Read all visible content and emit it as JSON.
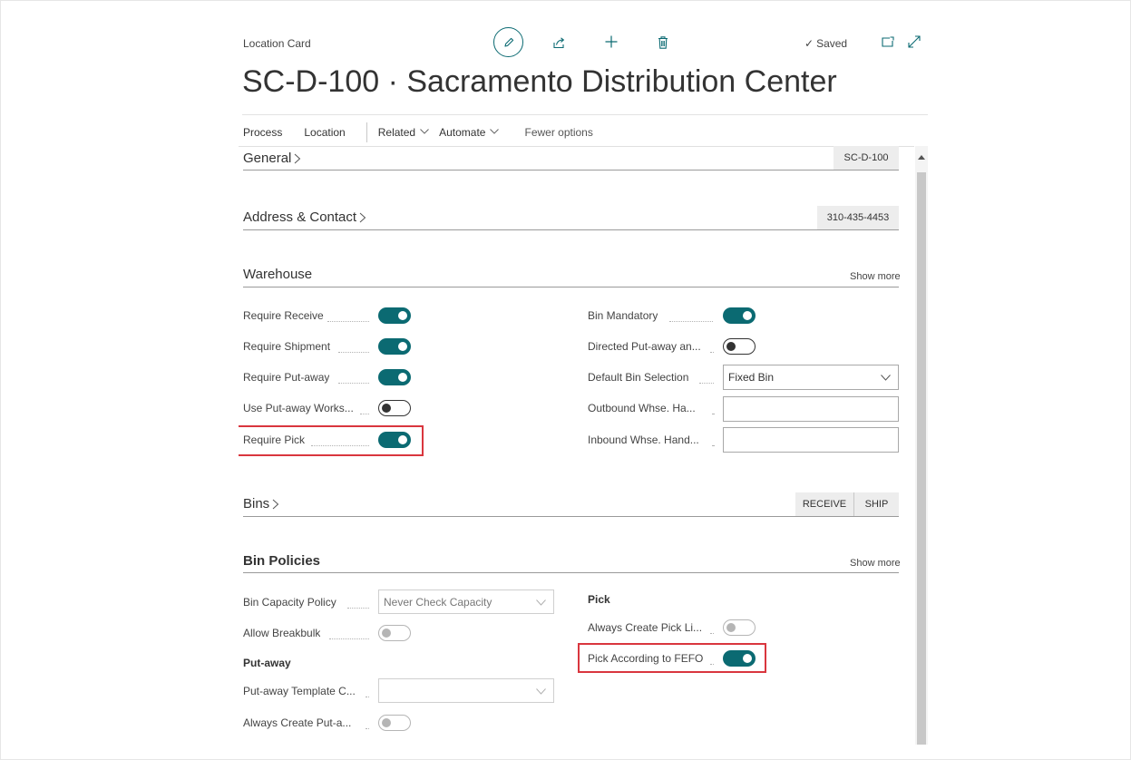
{
  "header": {
    "breadcrumb": "Location Card",
    "title": "SC-D-100 · Sacramento Distribution Center",
    "saved_label": "Saved",
    "saved_check": "✓"
  },
  "actions": {
    "process": "Process",
    "location": "Location",
    "related": "Related",
    "automate": "Automate",
    "fewer": "Fewer options"
  },
  "sections": {
    "general": {
      "title": "General",
      "badge": "SC-D-100"
    },
    "address": {
      "title": "Address & Contact",
      "badge": "310-435-4453"
    },
    "warehouse": {
      "title": "Warehouse",
      "show_more": "Show more",
      "left": [
        {
          "label": "Require Receive",
          "state": "on"
        },
        {
          "label": "Require Shipment",
          "state": "on"
        },
        {
          "label": "Require Put-away",
          "state": "on"
        },
        {
          "label": "Use Put-away Works...",
          "state": "off"
        },
        {
          "label": "Require Pick",
          "state": "on",
          "highlighted": true
        }
      ],
      "right": {
        "bin_mandatory": {
          "label": "Bin Mandatory",
          "state": "on"
        },
        "directed_putaway": {
          "label": "Directed Put-away an...",
          "state": "off"
        },
        "default_bin_selection": {
          "label": "Default Bin Selection",
          "value": "Fixed Bin"
        },
        "outbound": {
          "label": "Outbound Whse. Ha...",
          "value": ""
        },
        "inbound": {
          "label": "Inbound Whse. Hand...",
          "value": ""
        }
      }
    },
    "bins": {
      "title": "Bins",
      "receive": "RECEIVE",
      "ship": "SHIP"
    },
    "bin_policies": {
      "title": "Bin Policies",
      "show_more": "Show more",
      "bin_capacity_policy": {
        "label": "Bin Capacity Policy",
        "value": "Never Check Capacity"
      },
      "allow_breakbulk": {
        "label": "Allow Breakbulk",
        "state": "disabled-off"
      },
      "putaway_heading": "Put-away",
      "putaway_template": {
        "label": "Put-away Template C...",
        "value": ""
      },
      "always_create_putaway": {
        "label": "Always Create Put-a...",
        "state": "disabled-off"
      },
      "pick_heading": "Pick",
      "always_create_pick": {
        "label": "Always Create Pick Li...",
        "state": "disabled-off"
      },
      "pick_fefo": {
        "label": "Pick According to FEFO",
        "state": "on",
        "highlighted": true
      }
    }
  },
  "colors": {
    "accent": "#0b6a72",
    "highlight": "#d9363e",
    "text": "#333333"
  },
  "icons": [
    "edit-icon",
    "share-icon",
    "plus-icon",
    "delete-icon",
    "open-new-window-icon",
    "expand-icon",
    "chevron-right-icon",
    "chevron-down-icon"
  ]
}
